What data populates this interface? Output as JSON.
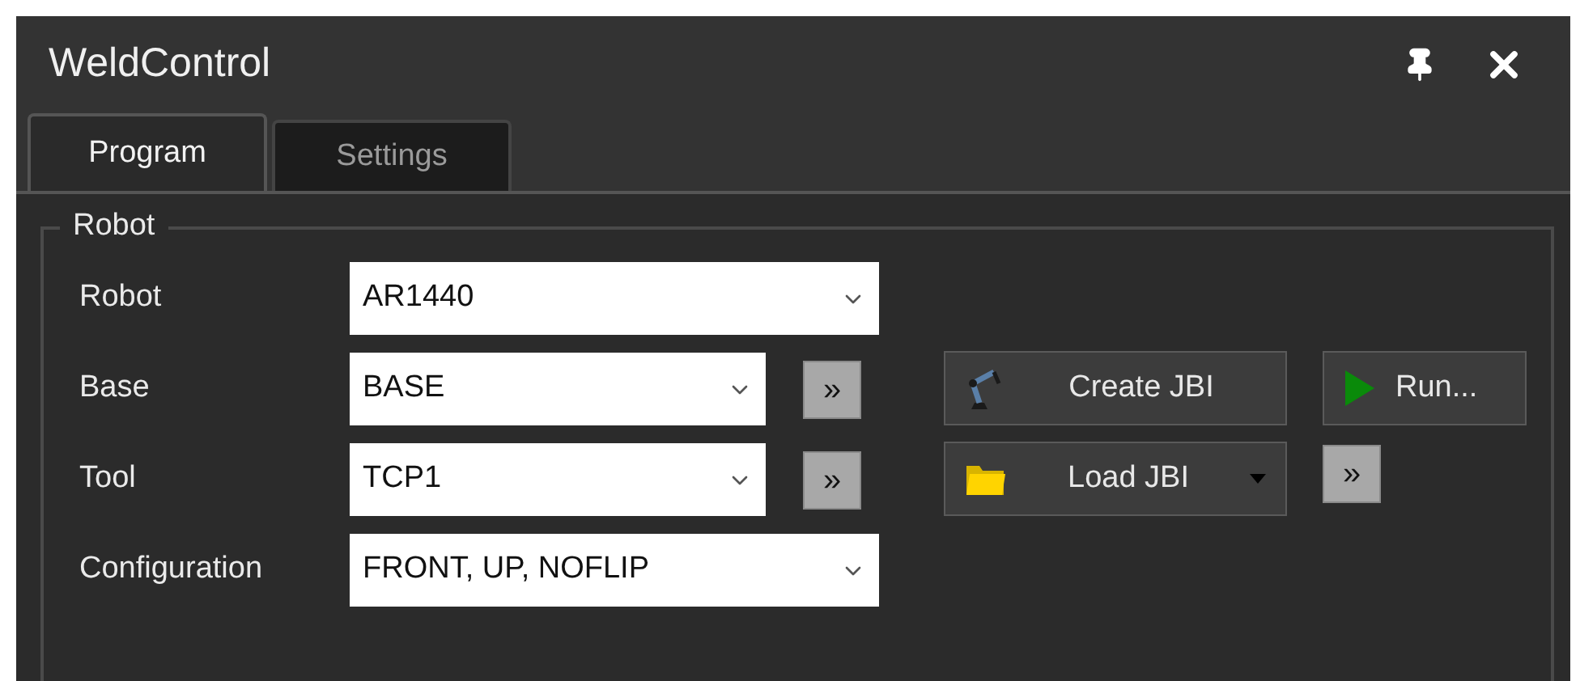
{
  "window": {
    "title": "WeldControl"
  },
  "tabs": [
    {
      "label": "Program",
      "selected": true
    },
    {
      "label": "Settings",
      "selected": false
    }
  ],
  "group": {
    "title": "Robot",
    "fields": [
      {
        "label": "Robot",
        "value": "AR1440"
      },
      {
        "label": "Base",
        "value": "BASE",
        "more": "»"
      },
      {
        "label": "Tool",
        "value": "TCP1",
        "more": "»"
      },
      {
        "label": "Configuration",
        "value": "FRONT, UP, NOFLIP"
      }
    ],
    "actions": [
      [
        {
          "kind": "robot",
          "label": "Create JBI"
        },
        {
          "kind": "run",
          "label": "Run..."
        }
      ],
      [
        {
          "kind": "load",
          "label": "Load JBI"
        },
        {
          "kind": "more",
          "label": "»"
        }
      ]
    ]
  }
}
